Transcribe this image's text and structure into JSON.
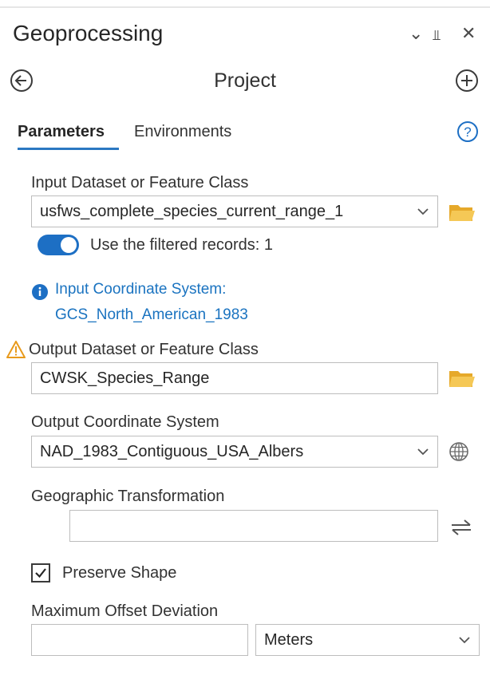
{
  "window": {
    "title": "Geoprocessing",
    "controls": {
      "dropdown_glyph": "⌄",
      "pin_glyph": "⫫",
      "close_glyph": "✕"
    }
  },
  "tool": {
    "name": "Project"
  },
  "tabs": [
    {
      "label": "Parameters",
      "active": true
    },
    {
      "label": "Environments",
      "active": false
    }
  ],
  "params": {
    "input_dataset": {
      "label": "Input Dataset or Feature Class",
      "value": "usfws_complete_species_current_range_1"
    },
    "filter_toggle": {
      "label": "Use the filtered records: 1",
      "on": true
    },
    "input_cs": {
      "line1": "Input Coordinate System:",
      "line2": "GCS_North_American_1983"
    },
    "output_dataset": {
      "label": "Output Dataset or Feature Class",
      "value": "CWSK_Species_Range"
    },
    "output_cs": {
      "label": "Output Coordinate System",
      "value": "NAD_1983_Contiguous_USA_Albers"
    },
    "geo_transform": {
      "label": "Geographic Transformation",
      "value": ""
    },
    "preserve_shape": {
      "label": "Preserve Shape",
      "checked": true
    },
    "max_offset": {
      "label": "Maximum Offset Deviation",
      "value": "",
      "unit": "Meters"
    }
  },
  "colors": {
    "accent": "#1d6fc4",
    "link": "#1a73c0",
    "folder": "#f2c14e",
    "warning": "#f0a01f"
  },
  "icons": {
    "back": "back-arrow-icon",
    "add": "add-icon",
    "help": "help-icon",
    "folder": "folder-icon",
    "info": "info-icon",
    "warning": "warning-icon",
    "globe": "globe-icon",
    "swap": "swap-icon",
    "check": "checkmark-icon",
    "chevron": "chevron-down-icon"
  }
}
